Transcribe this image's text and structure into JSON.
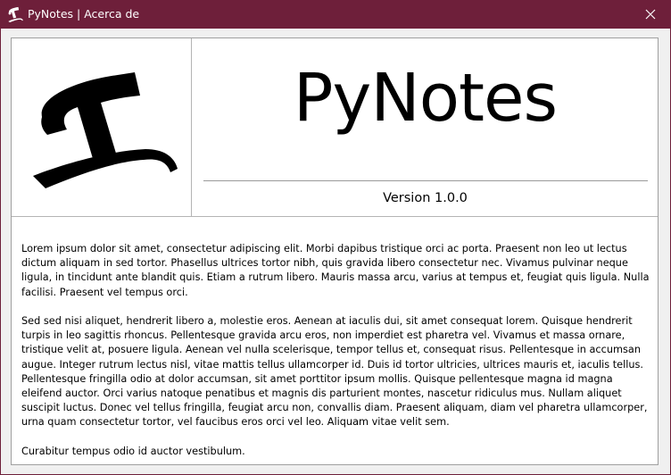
{
  "window": {
    "title": "PyNotes | Acerca de",
    "app_icon": "pynotes-logo-icon",
    "close_icon": "close-icon",
    "frame_color": "#6e1f3a"
  },
  "header": {
    "logo_icon": "pynotes-logo-icon",
    "app_name": "PyNotes",
    "version": "Version 1.0.0"
  },
  "about": {
    "paragraphs": [
      " Lorem ipsum dolor sit amet, consectetur adipiscing elit. Morbi dapibus tristique orci ac porta. Praesent non leo ut lectus dictum aliquam in sed tortor. Phasellus ultrices tortor nibh, quis gravida libero consectetur nec. Vivamus pulvinar neque ligula, in tincidunt ante blandit quis. Etiam a rutrum libero. Mauris massa arcu, varius at tempus et, feugiat quis ligula. Nulla facilisi. Praesent vel tempus orci.",
      "Sed sed nisi aliquet, hendrerit libero a, molestie eros. Aenean at iaculis dui, sit amet consequat lorem. Quisque hendrerit turpis in leo sagittis rhoncus. Pellentesque gravida arcu eros, non imperdiet est pharetra vel. Vivamus et massa ornare, tristique velit at, posuere ligula. Aenean vel nulla scelerisque, tempor tellus et, consequat risus. Pellentesque in accumsan augue. Integer rutrum lectus nisl, vitae mattis tellus ullamcorper id. Duis id tortor ultricies, ultrices mauris et, iaculis tellus. Pellentesque fringilla odio at dolor accumsan, sit amet porttitor ipsum mollis. Quisque pellentesque magna id magna eleifend auctor. Orci varius natoque penatibus et magnis dis parturient montes, nascetur ridiculus mus. Nullam aliquet suscipit luctus. Donec vel tellus fringilla, feugiat arcu non, convallis diam. Praesent aliquam, diam vel pharetra ullamcorper, urna quam consectetur tortor, vel faucibus eros orci vel leo. Aliquam vitae velit sem.",
      "Curabitur tempus odio id auctor vestibulum."
    ]
  }
}
